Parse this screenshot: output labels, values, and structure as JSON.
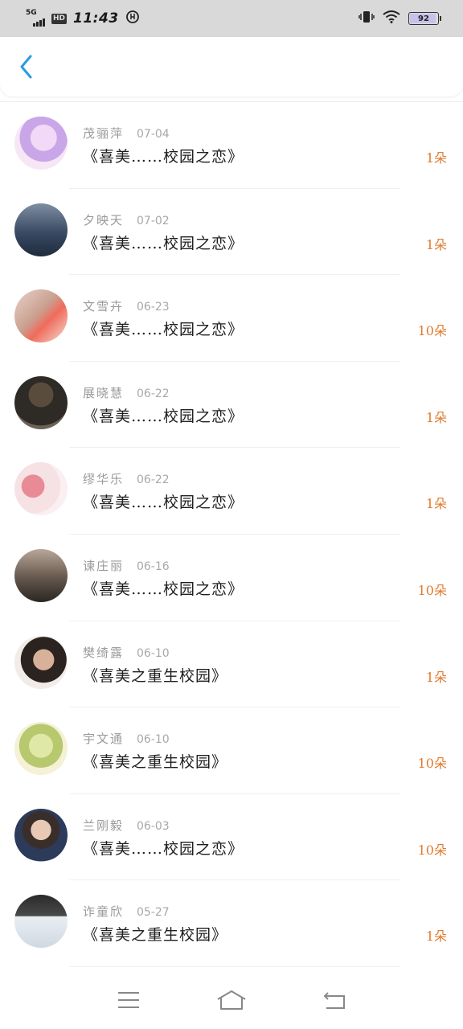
{
  "status_bar": {
    "network": "5G",
    "hd": "HD",
    "time": "11:43",
    "battery": "92",
    "battery_level": 0.92
  },
  "colors": {
    "accent": "#2a9be0",
    "gift": "#e07b2e",
    "status_bg": "#d9d9d9"
  },
  "records": [
    {
      "name": "茂骊萍",
      "date": "07-04",
      "title": "《喜美……校园之恋》",
      "gift": "1朵"
    },
    {
      "name": "夕映天",
      "date": "07-02",
      "title": "《喜美……校园之恋》",
      "gift": "1朵"
    },
    {
      "name": "文雪卉",
      "date": "06-23",
      "title": "《喜美……校园之恋》",
      "gift": "10朵"
    },
    {
      "name": "展晓慧",
      "date": "06-22",
      "title": "《喜美……校园之恋》",
      "gift": "1朵"
    },
    {
      "name": "缪华乐",
      "date": "06-22",
      "title": "《喜美……校园之恋》",
      "gift": "1朵"
    },
    {
      "name": "谏庄丽",
      "date": "06-16",
      "title": "《喜美……校园之恋》",
      "gift": "10朵"
    },
    {
      "name": "樊绮露",
      "date": "06-10",
      "title": "《喜美之重生校园》",
      "gift": "1朵"
    },
    {
      "name": "宇文通",
      "date": "06-10",
      "title": "《喜美之重生校园》",
      "gift": "10朵"
    },
    {
      "name": "兰刚毅",
      "date": "06-03",
      "title": "《喜美……校园之恋》",
      "gift": "10朵"
    },
    {
      "name": "诈童欣",
      "date": "05-27",
      "title": "《喜美之重生校园》",
      "gift": "1朵"
    }
  ]
}
